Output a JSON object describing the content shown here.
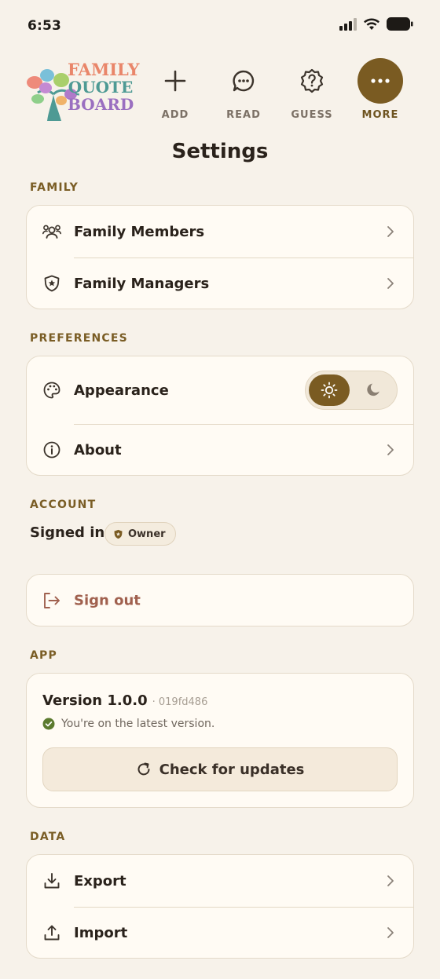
{
  "status_bar": {
    "time": "6:53"
  },
  "logo": {
    "line1": "FAMILY",
    "line2": "QUOTE",
    "line3": "BOARD"
  },
  "nav": {
    "items": [
      {
        "label": "ADD",
        "icon": "plus-icon"
      },
      {
        "label": "READ",
        "icon": "chat-bubble-icon"
      },
      {
        "label": "GUESS",
        "icon": "question-badge-icon"
      },
      {
        "label": "MORE",
        "icon": "more-dots-icon",
        "active": true
      }
    ]
  },
  "page": {
    "title": "Settings"
  },
  "family": {
    "section_label": "FAMILY",
    "members_label": "Family Members",
    "managers_label": "Family Managers"
  },
  "preferences": {
    "section_label": "PREFERENCES",
    "appearance_label": "Appearance",
    "appearance_mode": "light",
    "about_label": "About"
  },
  "account": {
    "section_label": "ACCOUNT",
    "signed_in_label": "Signed in",
    "role_badge": "Owner",
    "sign_out_label": "Sign out"
  },
  "app": {
    "section_label": "APP",
    "version": "Version 1.0.0",
    "build": "· 019fd486",
    "status": "You're on the latest version.",
    "check_updates_label": "Check for updates"
  },
  "data": {
    "section_label": "DATA",
    "export_label": "Export",
    "import_label": "Import"
  },
  "colors": {
    "accent": "#7a5b22",
    "background": "#f7f2ea",
    "card": "#fffbf4",
    "danger_text": "#a0604e",
    "success": "#5b7a2e"
  }
}
